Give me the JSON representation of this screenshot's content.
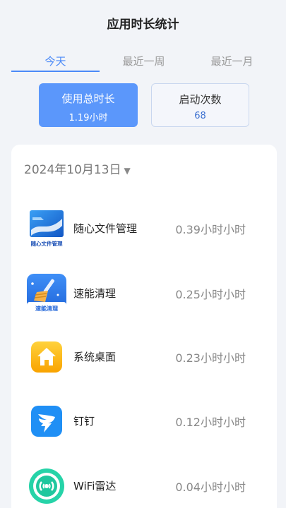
{
  "header": {
    "title": "应用时长统计"
  },
  "tabs": [
    {
      "label": "今天",
      "active": true
    },
    {
      "label": "最近一周",
      "active": false
    },
    {
      "label": "最近一月",
      "active": false
    }
  ],
  "stats": {
    "usage": {
      "label": "使用总时长",
      "value": "1.19小时"
    },
    "launches": {
      "label": "启动次数",
      "value": "68"
    }
  },
  "list": {
    "date": "2024年10月13日",
    "date_caret": "▼",
    "apps": [
      {
        "name": "随心文件管理",
        "time": "0.39小时小时",
        "icon": "file-manager-icon",
        "icon_caption": "随心文件管理"
      },
      {
        "name": "速能清理",
        "time": "0.25小时小时",
        "icon": "broom-cleaner-icon",
        "icon_caption": "速能清理"
      },
      {
        "name": "系统桌面",
        "time": "0.23小时小时",
        "icon": "home-icon"
      },
      {
        "name": "钉钉",
        "time": "0.12小时小时",
        "icon": "dingtalk-icon"
      },
      {
        "name": "WiFi雷达",
        "time": "0.04小时小时",
        "icon": "wifi-radar-icon"
      }
    ]
  },
  "colors": {
    "accent": "#4b8af8",
    "stat_active_bg": "#5b97fb",
    "background": "#f2f4f8"
  }
}
